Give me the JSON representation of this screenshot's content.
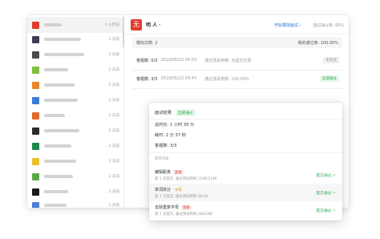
{
  "sidebar": {
    "items": [
      {
        "icon_color": "#e23b2e",
        "time": "1 小时前"
      },
      {
        "icon_color": "#3a3f56",
        "time": "2 天前"
      },
      {
        "icon_color": "#4a4a4a",
        "time": "2 天前"
      },
      {
        "icon_color": "#7fbf3b",
        "time": "2 天前"
      },
      {
        "icon_color": "#e8872a",
        "time": "2 天前"
      },
      {
        "icon_color": "#3a7bd5",
        "time": "2 天前"
      },
      {
        "icon_color": "#e26a2c",
        "time": "2 天前"
      },
      {
        "icon_color": "#2c2c2c",
        "time": "2 天前"
      },
      {
        "icon_color": "#1d8a4a",
        "time": "2 天前"
      },
      {
        "icon_color": "#e8c12a",
        "time": "2 天前"
      },
      {
        "icon_color": "#5aa845",
        "time": "2 天前"
      },
      {
        "icon_color": "#1a1a1a",
        "time": "2 天前"
      },
      {
        "icon_color": "#4d7fd8",
        "time": "2 天前"
      }
    ]
  },
  "header": {
    "app_logo_glyph": "无",
    "app_name": "明 人",
    "caret": "▾",
    "start_button": "开始模拟面试 ›",
    "pass_rate": "面试通过率: 60%"
  },
  "summary": {
    "attempts": "模拟次数: 2",
    "my_pass_rate": "我的通过率: 100.00%"
  },
  "records": [
    {
      "label": "答题数: 0/3",
      "date": "2019/05/22 04:03",
      "result": "通过测试用例: 无提交记录",
      "badge": "未完成",
      "badge_style": "gray"
    },
    {
      "label": "答题数: 3/3",
      "date": "2019/05/22 03:47",
      "result": "通过测试用例: 100.00%",
      "badge": "全部通过",
      "badge_style": "green"
    }
  ],
  "popup": {
    "result_label": "面试结果:",
    "result_value": "全部通过",
    "total_time": "总时长: 1 小时 30 分",
    "used_time": "耗时: 2 分 37 秒",
    "answered": "答题数: 3/3",
    "section_label": "题目列表",
    "problems": [
      {
        "name": "编辑距离",
        "difficulty": "困难",
        "difficulty_style": "hard",
        "detail": "第 1 次提交, 通过测试用例 1146/1146",
        "status": "提交通过 ✓"
      },
      {
        "name": "单词拆分",
        "difficulty": "中等",
        "difficulty_style": "mid",
        "detail": "第 1 次提交, 通过测试用例 36/36",
        "status": "提交通过 ✓"
      },
      {
        "name": "去除重复字母",
        "difficulty": "困难",
        "difficulty_style": "hard",
        "detail": "第 1 次提交, 通过测试用例 286/286",
        "status": "提交通过 ✓"
      }
    ]
  }
}
